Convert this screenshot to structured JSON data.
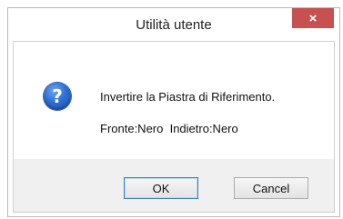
{
  "window": {
    "title": "Utilità utente",
    "close_label": "×"
  },
  "dialog": {
    "icon": "question-icon",
    "icon_glyph": "?",
    "message_line1": "Invertire la Piastra di Riferimento.",
    "message_line2": "Fronte:Nero  Indietro:Nero"
  },
  "buttons": {
    "ok_label": "OK",
    "cancel_label": "Cancel"
  },
  "colors": {
    "close_button": "#c75050",
    "icon_blue": "#2d6fd6",
    "footer_bg": "#f0f0f0"
  }
}
